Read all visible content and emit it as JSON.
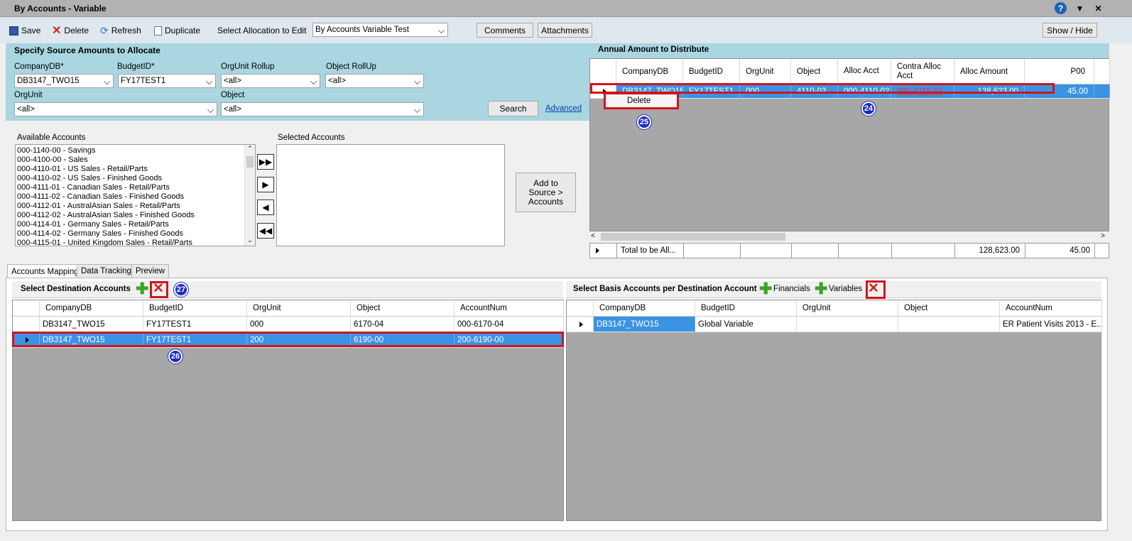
{
  "window": {
    "title": "By Accounts - Variable"
  },
  "toolbar": {
    "save": "Save",
    "delete": "Delete",
    "refresh": "Refresh",
    "duplicate": "Duplicate",
    "select_allocation_label": "Select Allocation to Edit",
    "allocation_value": "By Accounts Variable Test",
    "comments": "Comments",
    "attachments": "Attachments",
    "show_hide": "Show / Hide"
  },
  "source": {
    "title": "Specify Source Amounts to Allocate",
    "company_label": "CompanyDB*",
    "company_value": "DB3147_TWO15",
    "budget_label": "BudgetID*",
    "budget_value": "FY17TEST1",
    "orgunit_rollup_label": "OrgUnit Rollup",
    "orgunit_rollup_value": "<all>",
    "object_rollup_label": "Object RollUp",
    "object_rollup_value": "<all>",
    "orgunit_label": "OrgUnit",
    "orgunit_value": "<all>",
    "object_label": "Object",
    "object_value": "<all>",
    "search": "Search",
    "advanced": "Advanced"
  },
  "accounts": {
    "available_label": "Available Accounts",
    "selected_label": "Selected Accounts",
    "available": [
      "000-1140-00 - Savings",
      "000-4100-00 - Sales",
      "000-4110-01 - US Sales - Retail/Parts",
      "000-4110-02 - US Sales - Finished Goods",
      "000-4111-01 - Canadian Sales - Retail/Parts",
      "000-4111-02 - Canadian Sales - Finished Goods",
      "000-4112-01 - AustralAsian Sales - Retail/Parts",
      "000-4112-02 - AustralAsian Sales - Finished Goods",
      "000-4114-01 - Germany Sales - Retail/Parts",
      "000-4114-02 - Germany Sales - Finished Goods",
      "000-4115-01 - United Kingdom Sales - Retail/Parts"
    ],
    "add_button": "Add to Source > Accounts"
  },
  "annual": {
    "title": "Annual Amount to Distribute",
    "headers": [
      "CompanyDB",
      "BudgetID",
      "OrgUnit",
      "Object",
      "Alloc Acct",
      "Contra Alloc Acct",
      "Alloc Amount",
      "P00"
    ],
    "row": [
      "DB3147_TWO15",
      "FY17TEST1",
      "000",
      "4110-02",
      "000-4110-02",
      "000-4115-02",
      "128,623.00",
      "45.00"
    ],
    "context_menu_item": "Delete",
    "total_label": "Total to be All...",
    "total_amount": "128,623.00",
    "total_p00": "45.00"
  },
  "tabs": [
    "Accounts Mapping",
    "Data Tracking",
    "Preview"
  ],
  "dest": {
    "title": "Select Destination Accounts",
    "headers": [
      "CompanyDB",
      "BudgetID",
      "OrgUnit",
      "Object",
      "AccountNum"
    ],
    "rows": [
      [
        "DB3147_TWO15",
        "FY17TEST1",
        "000",
        "6170-04",
        "000-6170-04"
      ],
      [
        "DB3147_TWO15",
        "FY17TEST1",
        "200",
        "6190-00",
        "200-6190-00"
      ]
    ]
  },
  "basis": {
    "title": "Select Basis Accounts per Destination Account",
    "financials": "Financials",
    "variables": "Variables",
    "headers": [
      "CompanyDB",
      "BudgetID",
      "OrgUnit",
      "Object",
      "AccountNum"
    ],
    "row": [
      "DB3147_TWO15",
      "Global Variable",
      "",
      "",
      "ER Patient Visits 2013 - E..."
    ]
  },
  "badges": [
    "24",
    "25",
    "26",
    "27"
  ],
  "icons": [
    "save-icon",
    "delete-icon",
    "refresh-icon",
    "duplicate-icon",
    "help-icon",
    "minimize-icon",
    "close-icon",
    "plus-icon",
    "red-x-icon"
  ],
  "colors": {
    "source_panel": "#a9d6e1",
    "selection": "#3b93e4",
    "highlight": "#d2141a",
    "badge": "#1b2cc6"
  }
}
